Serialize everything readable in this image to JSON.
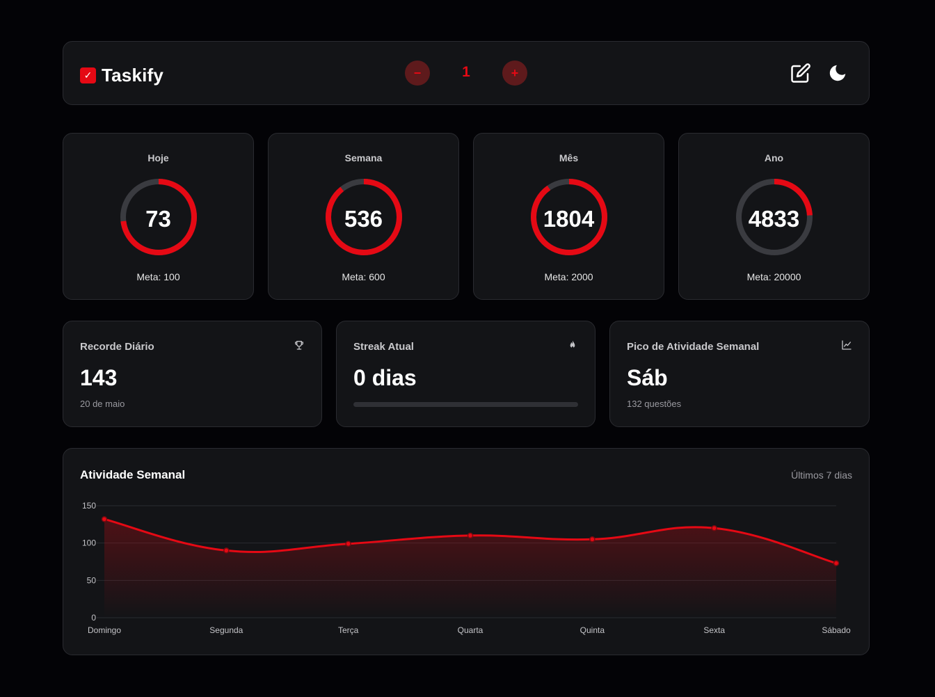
{
  "header": {
    "brand": "Taskify",
    "brand_check": "✓",
    "counter_value": "1",
    "minus_label": "−",
    "plus_label": "+"
  },
  "goals": [
    {
      "label": "Hoje",
      "value": "73",
      "meta": "Meta: 100",
      "progress": 0.73
    },
    {
      "label": "Semana",
      "value": "536",
      "meta": "Meta: 600",
      "progress": 0.8933
    },
    {
      "label": "Mês",
      "value": "1804",
      "meta": "Meta: 2000",
      "progress": 0.902
    },
    {
      "label": "Ano",
      "value": "4833",
      "meta": "Meta: 20000",
      "progress": 0.2417
    }
  ],
  "stats": {
    "record": {
      "label": "Recorde Diário",
      "value": "143",
      "sub": "20 de maio",
      "icon": "trophy-icon"
    },
    "streak": {
      "label": "Streak Atual",
      "value": "0 dias",
      "progress": 0,
      "icon": "flame-icon"
    },
    "peak": {
      "label": "Pico de Atividade Semanal",
      "value": "Sáb",
      "sub": "132 questões",
      "icon": "trending-up-icon"
    }
  },
  "chart": {
    "title": "Atividade Semanal",
    "range_label": "Últimos 7 dias"
  },
  "colors": {
    "accent": "#e50914",
    "card": "#131417",
    "background": "#030306"
  },
  "chart_data": {
    "type": "area",
    "categories": [
      "Domingo",
      "Segunda",
      "Terça",
      "Quarta",
      "Quinta",
      "Sexta",
      "Sábado"
    ],
    "values": [
      132,
      90,
      99,
      110,
      105,
      120,
      73
    ],
    "ylim": [
      0,
      150
    ],
    "yticks": [
      0,
      50,
      100,
      150
    ],
    "title": "",
    "xlabel": "",
    "ylabel": "",
    "grid": true
  }
}
